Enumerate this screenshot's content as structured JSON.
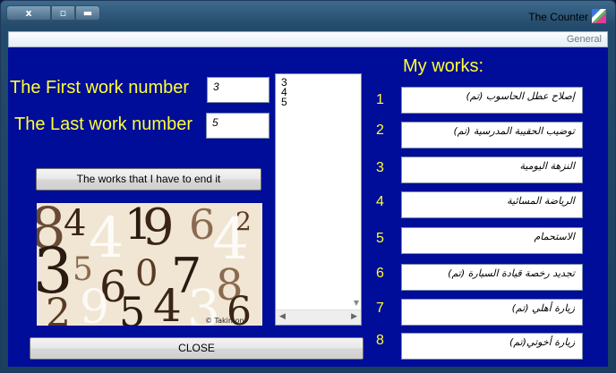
{
  "window": {
    "title": "The Counter",
    "close_glyph": "x",
    "max_glyph": "▫",
    "min_glyph": "▬",
    "tab_label": "General"
  },
  "form": {
    "first_label": "The First work number",
    "first_value": "3",
    "last_label": "The Last work number",
    "last_value": "5",
    "works_button": "The works that I have to end it",
    "close_button": "CLOSE",
    "list_items": [
      "3",
      "4",
      "5"
    ],
    "picture_credit": "© Takimon"
  },
  "works": {
    "heading": "My works:",
    "items": [
      {
        "num": "1",
        "text": "إصلاح عطل الحاسوب (تم)"
      },
      {
        "num": "2",
        "text": "توضيب الحقيبة المدرسية (تم)"
      },
      {
        "num": "3",
        "text": "النزهة اليومية"
      },
      {
        "num": "4",
        "text": "الرياضة المسائية"
      },
      {
        "num": "5",
        "text": "الاستحمام"
      },
      {
        "num": "6",
        "text": "تجديد رخصة قيادة السيارة (تم)"
      },
      {
        "num": "7",
        "text": "زيارة أهلي (تم)"
      },
      {
        "num": "8",
        "text": "زيارة أخوتي(تم)"
      }
    ]
  },
  "colors": {
    "background": "#000d99",
    "label_text": "#ffff33"
  }
}
